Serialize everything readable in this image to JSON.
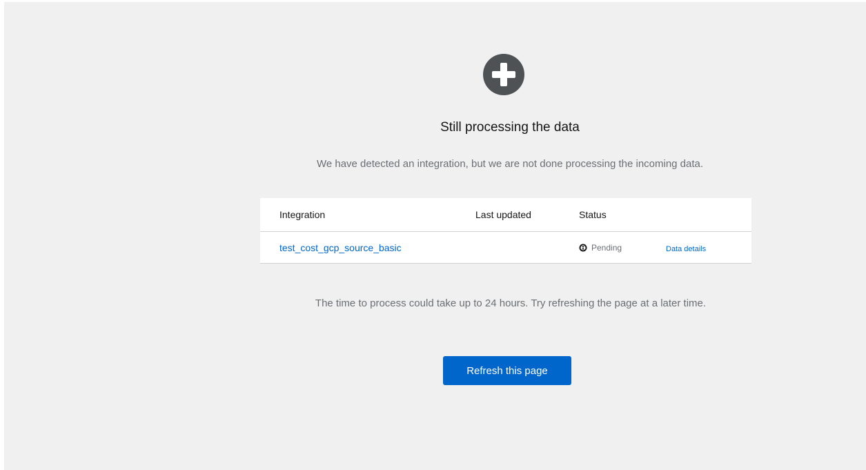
{
  "empty_state": {
    "icon": "plus-circle-icon",
    "title": "Still processing the data",
    "description": "We have detected an integration, but we are not done processing the incoming data.",
    "hint": "The time to process could take up to 24 hours. Try refreshing the page at a later time.",
    "refresh_label": "Refresh this page"
  },
  "table": {
    "columns": [
      "Integration",
      "Last updated",
      "Status"
    ],
    "rows": [
      {
        "integration": "test_cost_gcp_source_basic",
        "last_updated": "",
        "status": "Pending",
        "status_icon": "pending-icon",
        "details_label": "Data details"
      }
    ]
  },
  "colors": {
    "background": "#f0f0f0",
    "primary": "#0066cc",
    "icon": "#4f5255",
    "muted_text": "#6a6e73"
  }
}
